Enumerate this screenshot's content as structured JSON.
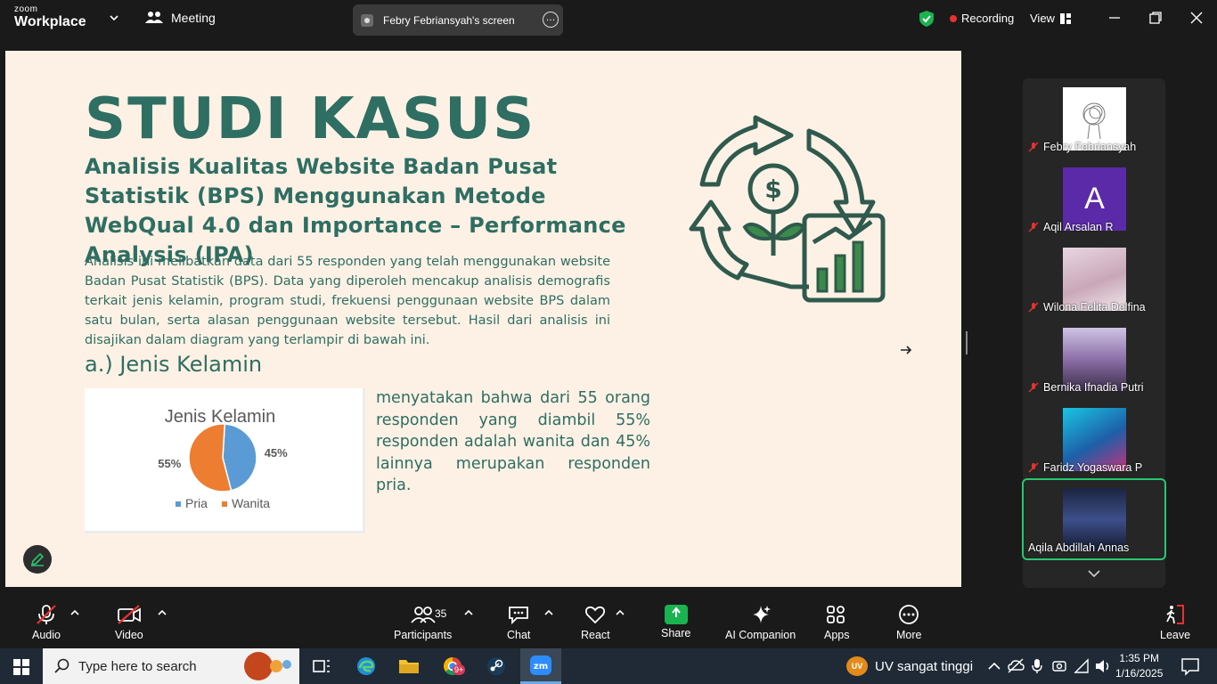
{
  "topbar": {
    "brand_top": "zoom",
    "brand_bottom": "Workplace",
    "meeting_label": "Meeting",
    "share_label": "Febry Febriansyah's screen",
    "more_label": "…",
    "recording_label": "Recording",
    "view_label": "View"
  },
  "slide": {
    "title": "STUDI KASUS",
    "subtitle": "Analisis Kualitas Website Badan Pusat Statistik (BPS) Menggunakan Metode WebQual 4.0 dan Importance – Performance Analysis (IPA)",
    "body": "Analisis ini melibatkan data dari 55 responden yang telah menggunakan website Badan Pusat Statistik (BPS). Data yang diperoleh mencakup analisis demografis terkait jenis kelamin, program studi, frekuensi penggunaan website BPS dalam satu bulan, serta alasan penggunaan website tersebut. Hasil dari analisis ini disajikan dalam diagram yang terlampir di bawah ini.",
    "section_heading": "a.) Jenis Kelamin",
    "description": "menyatakan bahwa dari 55 orang responden yang diambil 55% responden adalah wanita dan 45% lainnya merupakan responden pria."
  },
  "chart_data": {
    "type": "pie",
    "title": "Jenis Kelamin",
    "categories": [
      "Pria",
      "Wanita"
    ],
    "values": [
      45,
      55
    ],
    "labels": [
      "45%",
      "55%"
    ],
    "colors": [
      "#5b9bd5",
      "#ed7d31"
    ],
    "legend": "bottom"
  },
  "participants": [
    {
      "name": "Febry Febriansyah",
      "muted": true
    },
    {
      "name": "Aqil Arsalan R",
      "muted": true,
      "initial": "A"
    },
    {
      "name": "Wilona Felita Delfina",
      "muted": true
    },
    {
      "name": "Bernika Ifnadia Putri",
      "muted": true
    },
    {
      "name": "Faridz Yogaswara P",
      "muted": true
    },
    {
      "name": "Aqila Abdillah Annas",
      "muted": false,
      "active": true
    }
  ],
  "toolbar": {
    "audio": "Audio",
    "video": "Video",
    "participants": "Participants",
    "participants_count": "35",
    "chat": "Chat",
    "react": "React",
    "share": "Share",
    "ai": "AI Companion",
    "apps": "Apps",
    "more": "More",
    "leave": "Leave"
  },
  "taskbar": {
    "search_placeholder": "Type here to search",
    "weather_badge": "UV",
    "weather_text": "UV sangat tinggi",
    "time": "1:35 PM",
    "date": "1/16/2025",
    "chrome_badge": "9+"
  },
  "colors": {
    "accent_green": "#2f6e62",
    "slide_bg": "#fdf1e5",
    "share_green": "#1bb34f",
    "record_red": "#e5312f",
    "active_border": "#28c76f"
  }
}
